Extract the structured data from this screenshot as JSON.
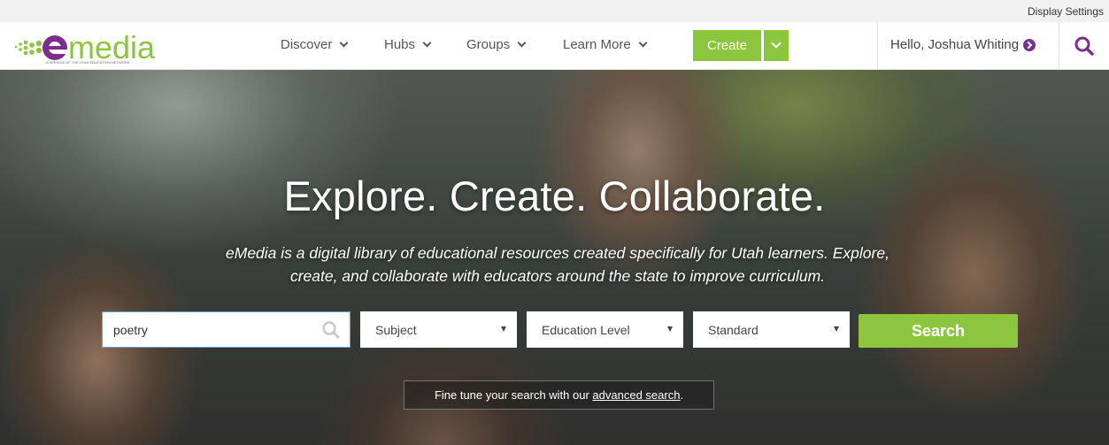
{
  "header": {
    "display_settings": "Display Settings",
    "logo_text": "emedia",
    "logo_tagline": "A SERVICE OF THE UTAH EDUCATION NETWORK",
    "nav": [
      {
        "label": "Discover"
      },
      {
        "label": "Hubs"
      },
      {
        "label": "Groups"
      },
      {
        "label": "Learn More"
      }
    ],
    "create_label": "Create",
    "greeting": "Hello, Joshua Whiting",
    "icons": [
      "chevron-down-icon",
      "arrow-circle-right-icon",
      "search-icon"
    ]
  },
  "hero": {
    "title": "Explore. Create. Collaborate.",
    "description_line1": "eMedia is a digital library of educational resources created specifically for Utah learners. Explore,",
    "description_line2": "create, and collaborate with educators around the state to improve curriculum.",
    "search": {
      "value": "poetry",
      "subject": "Subject",
      "education_level": "Education Level",
      "standard": "Standard",
      "button": "Search"
    },
    "fine_tune_prefix": "Fine tune your search with our ",
    "fine_tune_link": "advanced search",
    "fine_tune_suffix": "."
  },
  "colors": {
    "brand_purple": "#7a2f8f",
    "brand_green": "#8cc63f",
    "input_focus": "#6aa0d8"
  }
}
